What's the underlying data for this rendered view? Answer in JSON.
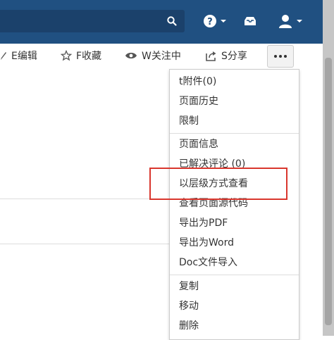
{
  "header": {
    "search_icon": "search-icon",
    "help_icon": "help-icon",
    "notifications_icon": "notifications-icon",
    "user_icon": "user-avatar-icon",
    "bar_color": "#205081"
  },
  "toolbar": {
    "edit_label": "E编辑",
    "favorite_label": "F收藏",
    "watch_label": "W关注中",
    "share_label": "S分享",
    "more_icon": "more-ellipsis-icon"
  },
  "menu": {
    "groups": [
      [
        "t附件(0)",
        "页面历史",
        "限制"
      ],
      [
        "页面信息",
        "已解决评论 (0)",
        "以层级方式查看",
        "查看页面源代码",
        "导出为PDF",
        "导出为Word",
        "Doc文件导入"
      ],
      [
        "复制",
        "移动",
        "删除"
      ]
    ],
    "highlighted_item": "以层级方式查看",
    "highlight_color": "#d9362d"
  }
}
